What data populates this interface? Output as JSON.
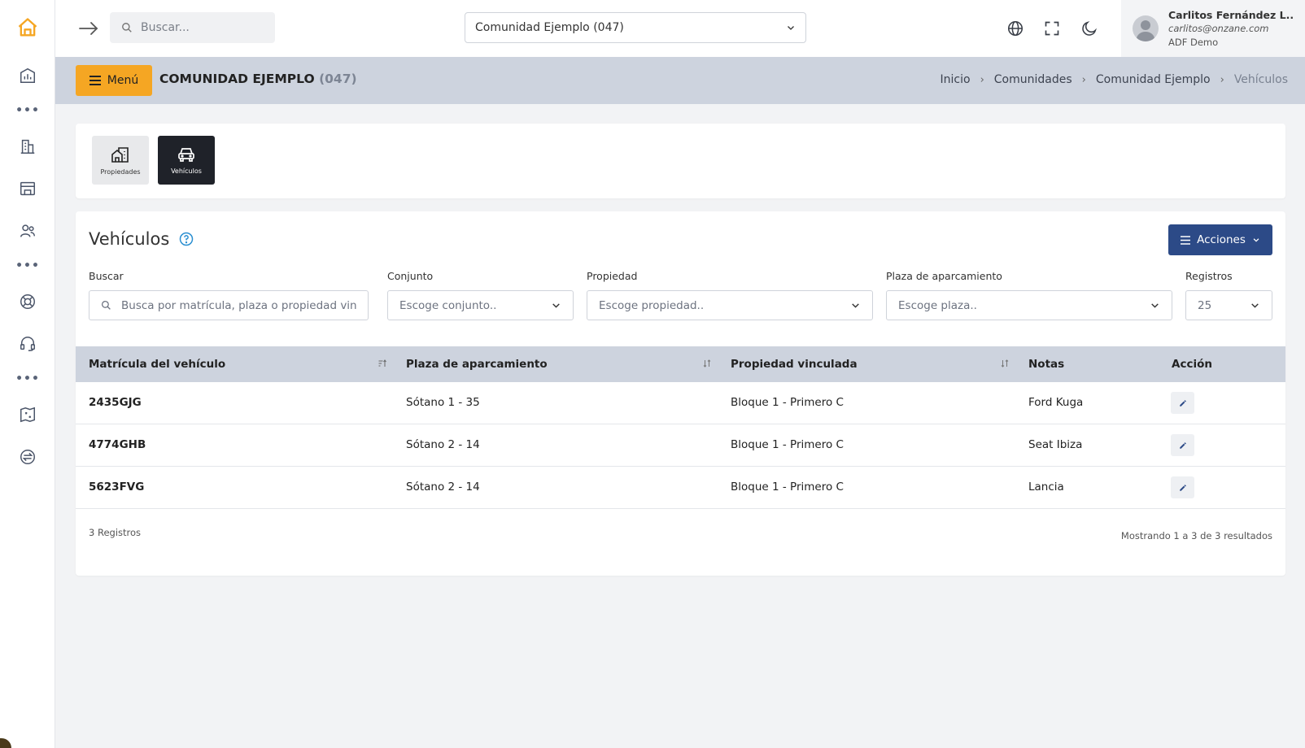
{
  "topbar": {
    "search_placeholder": "Buscar...",
    "community_selected": "Comunidad Ejemplo (047)",
    "user": {
      "name": "Carlitos Fernández L..",
      "email": "carlitos@onzane.com",
      "org": "ADF Demo"
    }
  },
  "rail": {
    "items": [
      "home-icon",
      "building-chart-icon",
      "more-dots-icon",
      "buildings-icon",
      "store-icon",
      "users-icon",
      "more-dots-icon",
      "lifebuoy-icon",
      "headset-icon",
      "more-dots-icon",
      "map-icon",
      "exchange-icon"
    ]
  },
  "header": {
    "menu_label": "Menú",
    "title": "COMUNIDAD EJEMPLO",
    "title_code": "(047)",
    "breadcrumb": [
      "Inicio",
      "Comunidades",
      "Comunidad Ejemplo",
      "Vehículos"
    ]
  },
  "tabs": [
    {
      "label": "Propiedades",
      "icon": "houses-icon",
      "active": false
    },
    {
      "label": "Vehículos",
      "icon": "car-icon",
      "active": true
    }
  ],
  "main": {
    "title": "Vehículos",
    "actions_label": "Acciones",
    "filters": {
      "search_label": "Buscar",
      "search_placeholder": "Busca por matrícula, plaza o propiedad vinculada",
      "conjunto_label": "Conjunto",
      "conjunto_value": "Escoge conjunto..",
      "propiedad_label": "Propiedad",
      "propiedad_value": "Escoge propiedad..",
      "plaza_label": "Plaza de aparcamiento",
      "plaza_value": "Escoge plaza..",
      "registros_label": "Registros",
      "registros_value": "25"
    },
    "table": {
      "headers": [
        "Matrícula del vehículo",
        "Plaza de aparcamiento",
        "Propiedad vinculada",
        "Notas",
        "Acción"
      ],
      "rows": [
        {
          "plate": "2435GJG",
          "spot": "Sótano 1 - 35",
          "property": "Bloque 1 - Primero C",
          "notes": "Ford Kuga"
        },
        {
          "plate": "4774GHB",
          "spot": "Sótano 2 - 14",
          "property": "Bloque 1 - Primero C",
          "notes": "Seat Ibiza"
        },
        {
          "plate": "5623FVG",
          "spot": "Sótano 2 - 14",
          "property": "Bloque 1 - Primero C",
          "notes": "Lancia"
        }
      ]
    },
    "footer_count": "3 Registros",
    "footer_range": "Mostrando 1 a 3 de 3 resultados"
  },
  "colors": {
    "accent_orange": "#f5a623",
    "primary_blue": "#2c4a87",
    "header_strip": "#cdd3de",
    "help_blue": "#2b8fd1"
  }
}
